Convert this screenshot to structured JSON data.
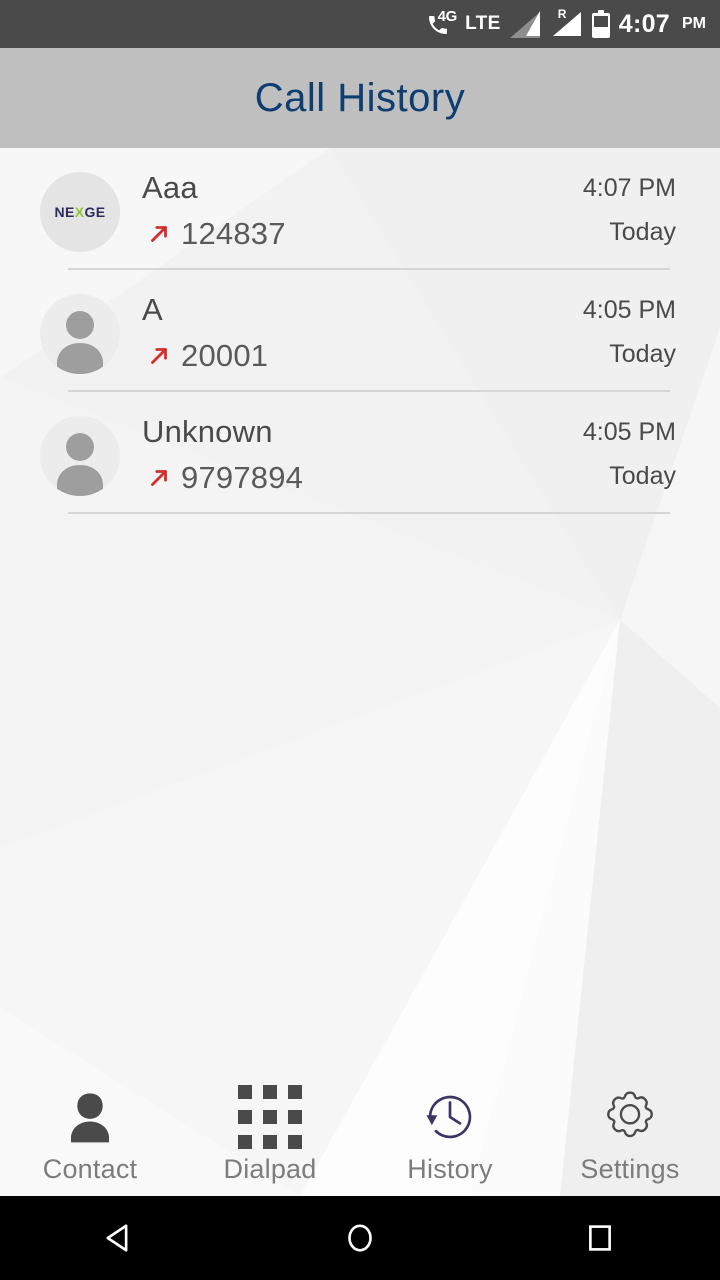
{
  "status_bar": {
    "network_badge": "4G",
    "network_type": "LTE",
    "roaming_indicator": "R",
    "time": "4:07",
    "ampm": "PM",
    "icons": [
      "phone-4g-icon",
      "signal-bars-icon",
      "signal-roaming-icon",
      "battery-icon"
    ]
  },
  "app_bar": {
    "title": "Call History",
    "title_color": "#0e3d72",
    "background_color": "#bfbfbf"
  },
  "call_list": {
    "accent_outgoing_color": "#d32f2f",
    "rows": [
      {
        "name": "Aaa",
        "number": "124837",
        "time": "4:07 PM",
        "day": "Today",
        "call_type": "outgoing",
        "avatar_type": "logo",
        "avatar_logo": "NEXGE"
      },
      {
        "name": "A",
        "number": "20001",
        "time": "4:05 PM",
        "day": "Today",
        "call_type": "outgoing",
        "avatar_type": "placeholder",
        "avatar_logo": ""
      },
      {
        "name": "Unknown",
        "number": "9797894",
        "time": "4:05 PM",
        "day": "Today",
        "call_type": "outgoing",
        "avatar_type": "placeholder",
        "avatar_logo": ""
      }
    ]
  },
  "tab_bar": {
    "active_tab": "History",
    "active_color": "#3b3564",
    "tabs": [
      {
        "label": "Contact",
        "icon": "person-icon"
      },
      {
        "label": "Dialpad",
        "icon": "dialpad-grid-icon"
      },
      {
        "label": "History",
        "icon": "clock-history-icon"
      },
      {
        "label": "Settings",
        "icon": "gear-icon"
      }
    ]
  },
  "android_nav": {
    "buttons": [
      {
        "name": "back",
        "icon": "back-triangle-icon"
      },
      {
        "name": "home",
        "icon": "home-circle-icon"
      },
      {
        "name": "recents",
        "icon": "recents-square-icon"
      }
    ]
  }
}
